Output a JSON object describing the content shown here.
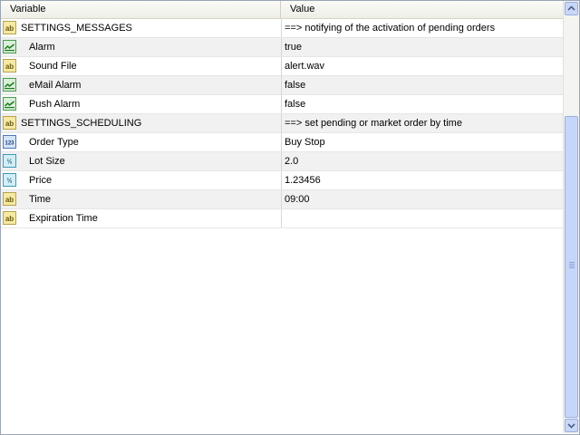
{
  "columns": {
    "variable": "Variable",
    "value": "Value"
  },
  "rows": [
    {
      "name": "SETTINGS_MESSAGES",
      "value": "==> notifying of the activation of pending orders",
      "type": "string",
      "icon": "ab-icon",
      "group": true
    },
    {
      "name": "Alarm",
      "value": "true",
      "type": "bool",
      "icon": "bool-icon",
      "group": false
    },
    {
      "name": "Sound File",
      "value": "alert.wav",
      "type": "string",
      "icon": "ab-icon",
      "group": false
    },
    {
      "name": "eMail Alarm",
      "value": "false",
      "type": "bool",
      "icon": "bool-icon",
      "group": false
    },
    {
      "name": "Push Alarm",
      "value": "false",
      "type": "bool",
      "icon": "bool-icon",
      "group": false
    },
    {
      "name": "SETTINGS_SCHEDULING",
      "value": "==> set pending or market order by time",
      "type": "string",
      "icon": "ab-icon",
      "group": true
    },
    {
      "name": "Order Type",
      "value": "Buy Stop",
      "type": "int",
      "icon": "int-icon",
      "group": false
    },
    {
      "name": "Lot Size",
      "value": "2.0",
      "type": "double",
      "icon": "double-icon",
      "group": false
    },
    {
      "name": "Price",
      "value": "1.23456",
      "type": "double",
      "icon": "double-icon",
      "group": false
    },
    {
      "name": "Time",
      "value": "09:00",
      "type": "string",
      "icon": "ab-icon",
      "group": false
    },
    {
      "name": "Expiration Time",
      "value": "",
      "type": "string",
      "icon": "ab-icon",
      "group": false
    }
  ],
  "colors": {
    "alt_row": "#f1f1f1",
    "scroll_accent": "#c6d6fa"
  }
}
